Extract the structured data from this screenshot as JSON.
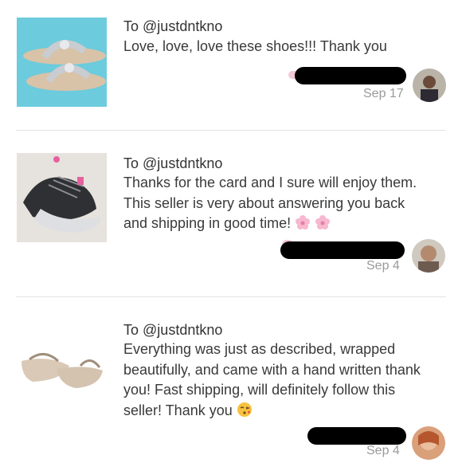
{
  "reviews": [
    {
      "to_prefix": "To",
      "to_handle": "@justdntkno",
      "message_lines": [
        "Love, love, love these shoes!!! Thank you"
      ],
      "date": "Sep 17",
      "thumbnail_icon": "silver-sandal-photo",
      "avatar_icon": "reviewer-avatar"
    },
    {
      "to_prefix": "To",
      "to_handle": "@justdntkno",
      "message_lines": [
        "Thanks for the card and I sure will enjoy them.",
        "This seller is very about answering you back",
        "and shipping in good time!"
      ],
      "emoji": "cherry-blossom-icon",
      "date": "Sep 4",
      "thumbnail_icon": "black-sneaker-photo",
      "avatar_icon": "reviewer-avatar"
    },
    {
      "to_prefix": "To",
      "to_handle": "@justdntkno",
      "message_lines": [
        "Everything was just as described, wrapped",
        "beautifully, and came with a hand written thank",
        "you! Fast shipping, will definitely follow this",
        "seller! Thank you"
      ],
      "emoji": "kissing-face-icon",
      "date": "Sep 4",
      "thumbnail_icon": "nude-flat-photo",
      "avatar_icon": "reviewer-avatar"
    }
  ],
  "colors": {
    "text": "#3a3a3a",
    "date": "#9a9a9a",
    "divider": "#e3e3e3",
    "redaction": "#000000"
  }
}
